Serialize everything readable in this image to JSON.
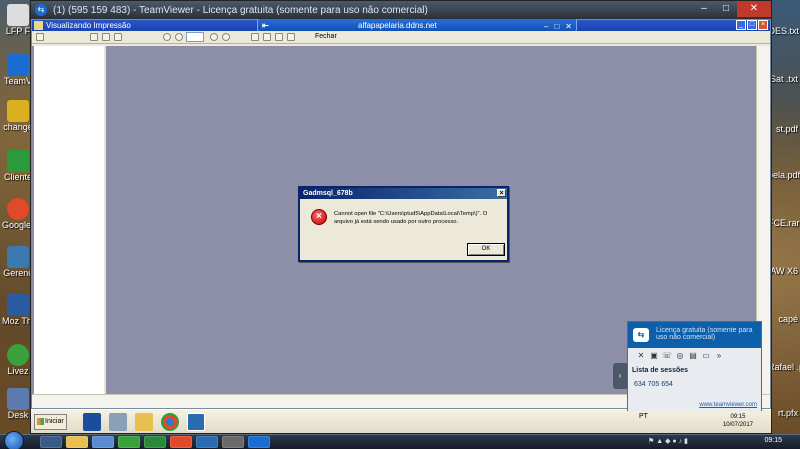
{
  "teamviewer": {
    "window_title": "(1) (595 159 483) - TeamViewer - Licença gratuita (somente para uso não comercial)",
    "floatbar_host": "alfapapelaria.ddns.net",
    "floatbar_pin": "⇤"
  },
  "print_preview": {
    "title": "Visualizando Impressão",
    "close_label": "Fechar",
    "page_value": ""
  },
  "dialog": {
    "title": "Gadmsql_678b",
    "message": "Cannot open file \"C:\\Users\\ptud5\\AppData\\Local\\Temp\\)\". O arquivo já está sendo usado por outro processo.",
    "ok_label": "OK",
    "close_glyph": "×",
    "icon_glyph": "×"
  },
  "remote_taskbar": {
    "start_label": "Iniciar",
    "tray_text": "PT",
    "time": "09:15",
    "date": "10/07/2017"
  },
  "tv_panel": {
    "banner": "Licença gratuita (somente para uso não comercial)",
    "session_list_label": "Lista de sessões",
    "session_id": "634 705 654",
    "website": "www.teamviewer.com",
    "collapse_glyph": "›"
  },
  "local_desktop": {
    "left_icons": [
      "LFP F",
      "TeamV",
      "change",
      "Cliente",
      "Google C",
      "Gerenc",
      "Moz Thund",
      "Livez",
      "Desk"
    ],
    "right_icons": [
      "OES.txt",
      "Sat .txt",
      "st.pdf",
      "bela.pdf",
      "FCE.rar",
      "AW X6",
      "capé",
      "Rafael .pdf",
      "rt.pfx"
    ]
  },
  "local_taskbar": {
    "time": "09:15"
  },
  "colors": {
    "remote_bg": "#8d8ea8",
    "xp_title": "#1943b0",
    "error_red": "#c00000"
  }
}
